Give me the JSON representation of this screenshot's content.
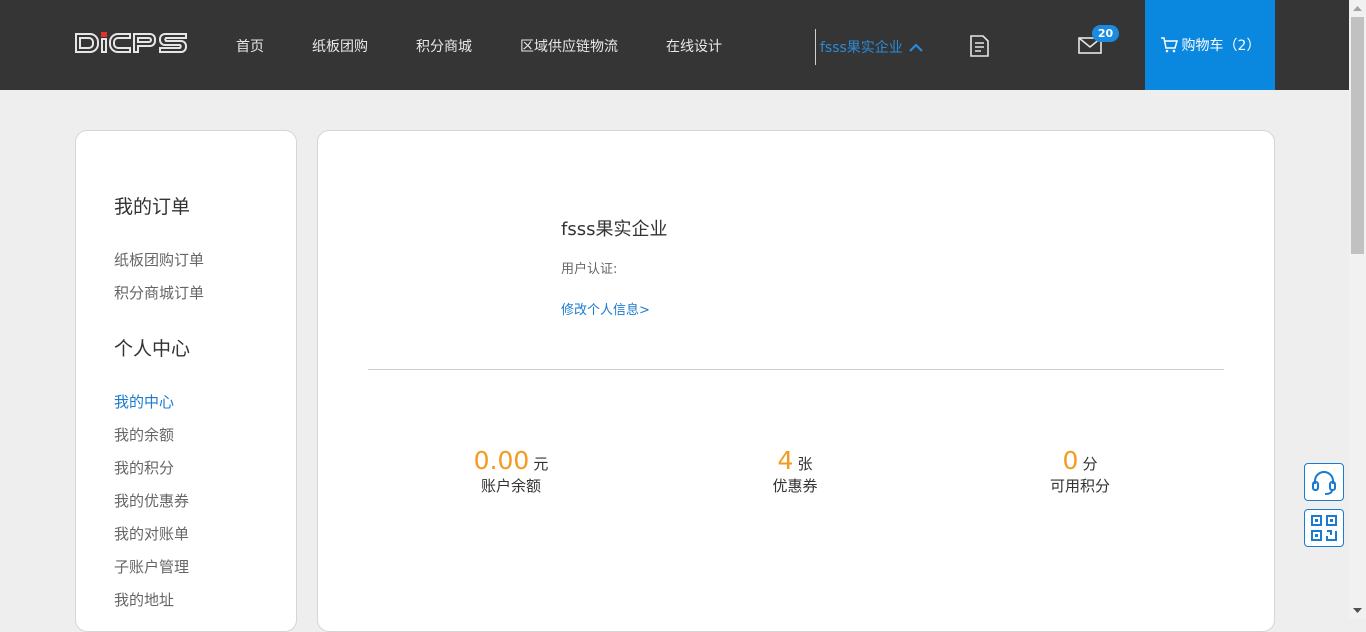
{
  "header": {
    "logo_text": "DiCPS",
    "nav": [
      "首页",
      "纸板团购",
      "积分商城",
      "区域供应链物流",
      "在线设计"
    ],
    "user_name": "fsss果实企业",
    "message_count": "20",
    "cart_label": "购物车（2）"
  },
  "sidebar": {
    "orders_title": "我的订单",
    "order_links": [
      "纸板团购订单",
      "积分商城订单"
    ],
    "personal_title": "个人中心",
    "personal_links": [
      "我的中心",
      "我的余额",
      "我的积分",
      "我的优惠券",
      "我的对账单",
      "子账户管理",
      "我的地址"
    ],
    "active_link": "我的中心"
  },
  "profile": {
    "company_name": "fsss果实企业",
    "certification_label": "用户认证:",
    "edit_link": "修改个人信息>"
  },
  "stats": [
    {
      "value": "0.00",
      "unit": "元",
      "label": "账户余额"
    },
    {
      "value": "4",
      "unit": "张",
      "label": "优惠券"
    },
    {
      "value": "0",
      "unit": "分",
      "label": "可用积分"
    }
  ],
  "float_buttons": [
    "headset-icon",
    "qr-code-icon"
  ],
  "colors": {
    "header_bg": "#353535",
    "accent_blue": "#0a88e0",
    "link_blue": "#1a7bd0",
    "stat_orange": "#f39a21"
  }
}
